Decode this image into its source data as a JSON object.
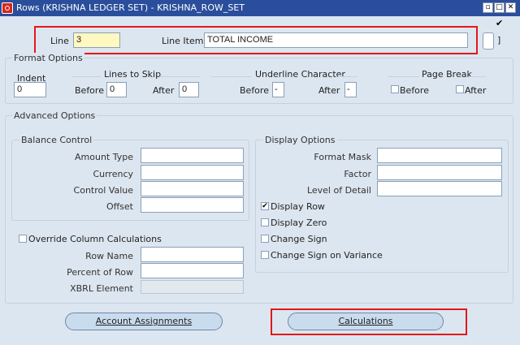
{
  "window": {
    "title": "Rows (KRISHNA LEDGER SET) - KRISHNA_ROW_SET",
    "min_glyph": "▫",
    "max_glyph": "□",
    "close_glyph": "✕"
  },
  "header": {
    "line_label": "Line",
    "line_value": "3",
    "line_item_label": "Line Item",
    "line_item_value": "TOTAL INCOME",
    "corner_check": "✔",
    "side_bracket": "]"
  },
  "format_options": {
    "title": "Format Options",
    "indent_label": "Indent",
    "indent_value": "0",
    "lines_to_skip_title": "Lines to Skip",
    "before_label": "Before",
    "before_value": "0",
    "after_label": "After",
    "after_value": "0",
    "underline_title": "Underline Character",
    "underline_before_label": "Before",
    "underline_before_value": "-",
    "underline_after_label": "After",
    "underline_after_value": "-",
    "page_break_title": "Page Break",
    "pb_before_label": "Before",
    "pb_after_label": "After"
  },
  "advanced": {
    "title": "Advanced Options",
    "balance_control": {
      "title": "Balance Control",
      "amount_type_label": "Amount Type",
      "currency_label": "Currency",
      "control_value_label": "Control Value",
      "offset_label": "Offset"
    },
    "display_options": {
      "title": "Display Options",
      "format_mask_label": "Format Mask",
      "factor_label": "Factor",
      "level_of_detail_label": "Level of Detail",
      "display_row_label": "Display Row",
      "display_row_checked": "✔",
      "display_zero_label": "Display Zero",
      "change_sign_label": "Change Sign",
      "change_sign_variance_label": "Change Sign on Variance"
    },
    "override_label": "Override Column Calculations",
    "row_name_label": "Row Name",
    "percent_of_row_label": "Percent of Row",
    "xbrl_label": "XBRL Element"
  },
  "buttons": {
    "account_assignments": "Account Assignments",
    "calculations": "Calculations"
  }
}
